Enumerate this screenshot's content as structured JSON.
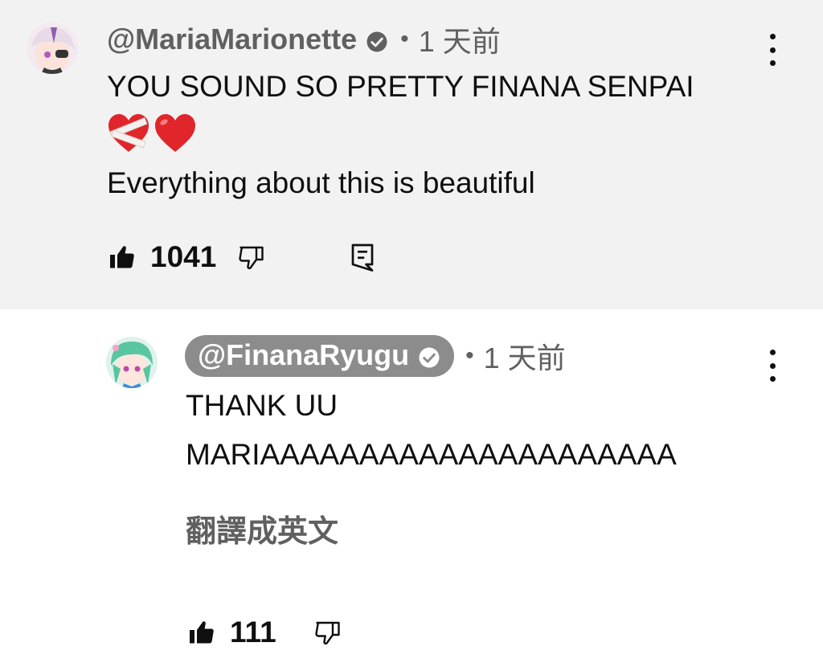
{
  "comment": {
    "author": "@MariaMarionette",
    "dot": "•",
    "time": "1 天前",
    "line1": "YOU SOUND SO PRETTY FINANA SENPAI",
    "emoji": "❤️‍🩹❤️",
    "line2": "Everything about this is beautiful",
    "like_count": "1041"
  },
  "reply": {
    "author": "@FinanaRyugu",
    "dot": "•",
    "time": "1 天前",
    "line1": "THANK UU",
    "line2": "MARIAAAAAAAAAAAAAAAAAAAAA",
    "translate_label": "翻譯成英文",
    "like_count": "111"
  },
  "colors": {
    "highlight_bg": "#f2f2f2",
    "secondary_text": "#606060",
    "author_chip": "#8c8c8c",
    "heart_red": "#e0262b"
  },
  "icons": {
    "verified": "verified-check-icon",
    "menu": "more-vert-icon",
    "like": "thumb-up-filled-icon",
    "dislike": "thumb-down-outline-icon",
    "reply": "comment-reply-icon"
  }
}
